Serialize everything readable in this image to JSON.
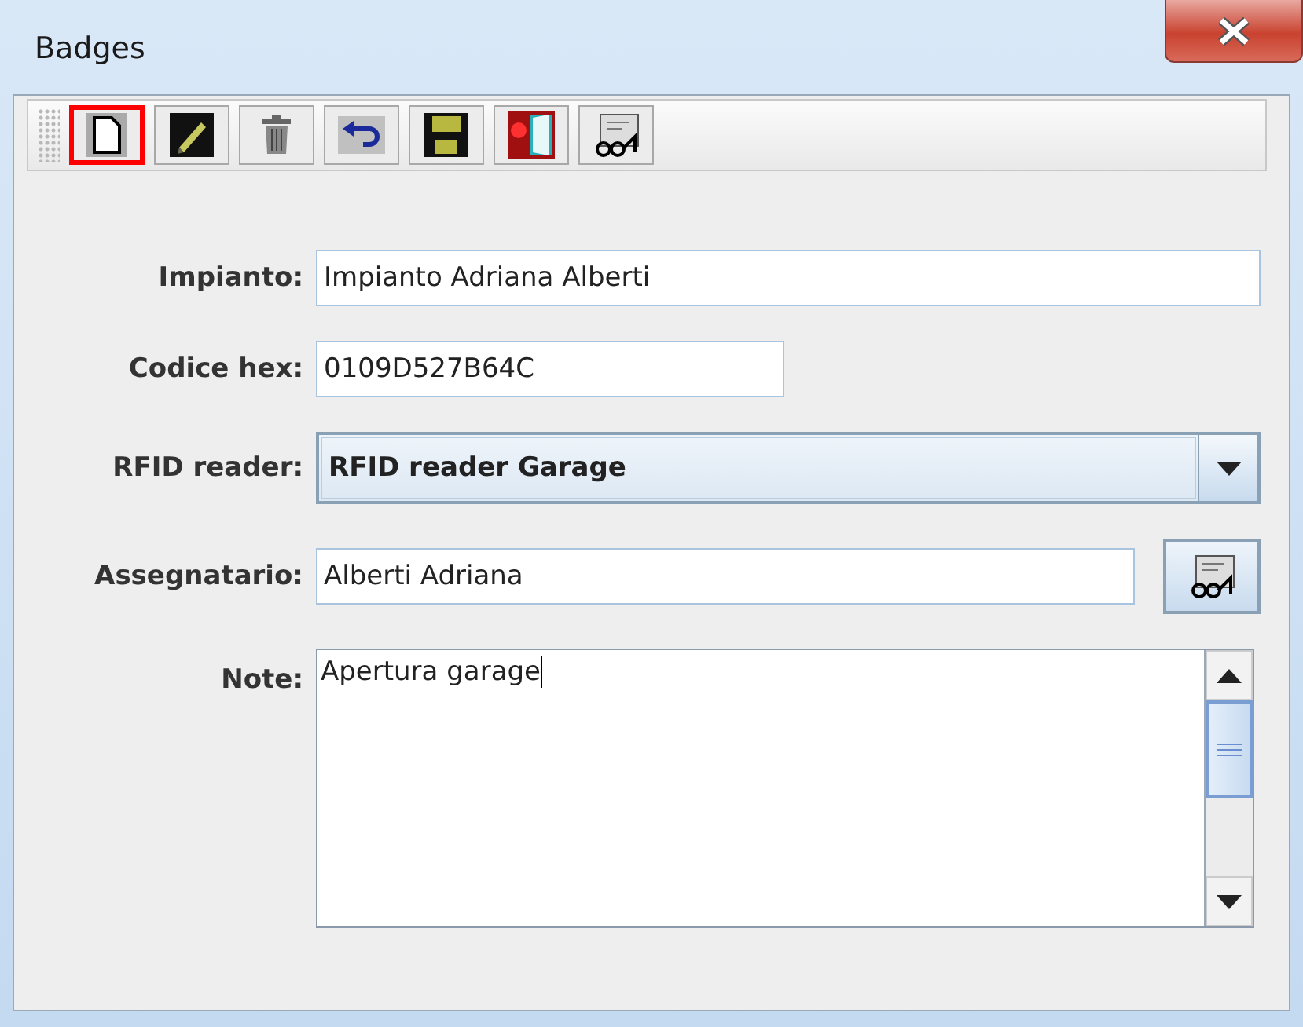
{
  "window": {
    "title": "Badges"
  },
  "toolbar": [
    {
      "kind": "new",
      "selected": true
    },
    {
      "kind": "edit",
      "selected": false
    },
    {
      "kind": "delete",
      "selected": false
    },
    {
      "kind": "undo",
      "selected": false
    },
    {
      "kind": "save",
      "selected": false
    },
    {
      "kind": "exit",
      "selected": false
    },
    {
      "kind": "search",
      "selected": false
    }
  ],
  "form": {
    "impianto": {
      "label": "Impianto:",
      "value": "Impianto Adriana Alberti"
    },
    "codice_hex": {
      "label": "Codice hex:",
      "value": "0109D527B64C"
    },
    "rfid_reader": {
      "label": "RFID reader:",
      "value": "RFID reader Garage"
    },
    "assegnatario": {
      "label": "Assegnatario:",
      "value": "Alberti Adriana"
    },
    "note": {
      "label": "Note:",
      "value": "Apertura garage"
    }
  }
}
